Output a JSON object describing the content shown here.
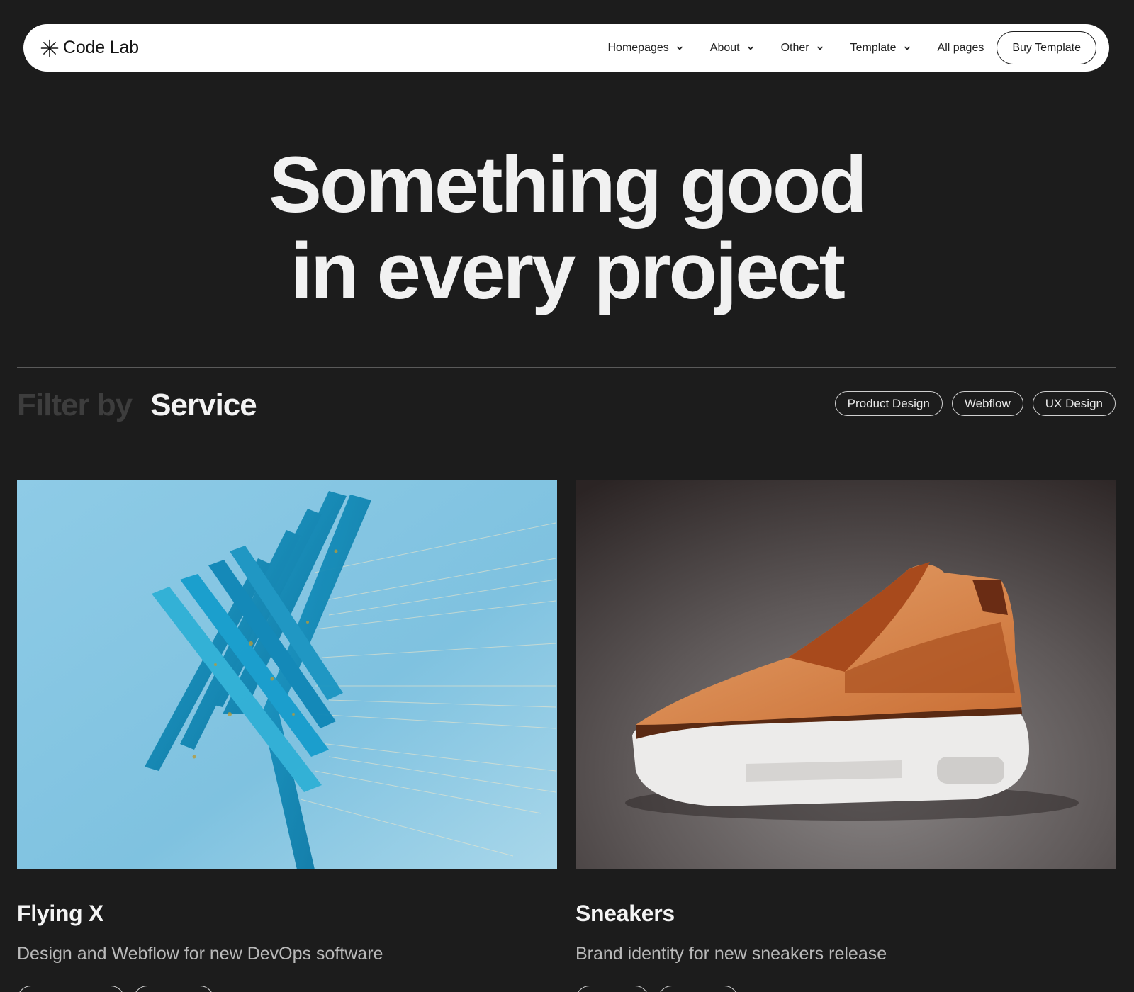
{
  "brand": {
    "name": "Code Lab",
    "logo_icon": "asterisk-icon"
  },
  "nav": {
    "items": [
      {
        "label": "Homepages",
        "has_dropdown": true
      },
      {
        "label": "About",
        "has_dropdown": true
      },
      {
        "label": "Other",
        "has_dropdown": true
      },
      {
        "label": "Template",
        "has_dropdown": true
      },
      {
        "label": "All pages",
        "has_dropdown": false
      }
    ],
    "cta": "Buy Template"
  },
  "hero": {
    "line1": "Something good",
    "line2": "in every project"
  },
  "filter": {
    "prefix": "Filter by",
    "value": "Service",
    "chips": [
      "Product Design",
      "Webflow",
      "UX Design"
    ]
  },
  "projects": [
    {
      "title": "Flying X",
      "description": "Design and Webflow for new DevOps software"
    },
    {
      "title": "Sneakers",
      "description": "Brand identity for new sneakers release"
    }
  ],
  "colors": {
    "background": "#1c1c1c",
    "nav_bg": "#ffffff",
    "text": "#f1f1f1",
    "muted": "#3d3d3d"
  }
}
